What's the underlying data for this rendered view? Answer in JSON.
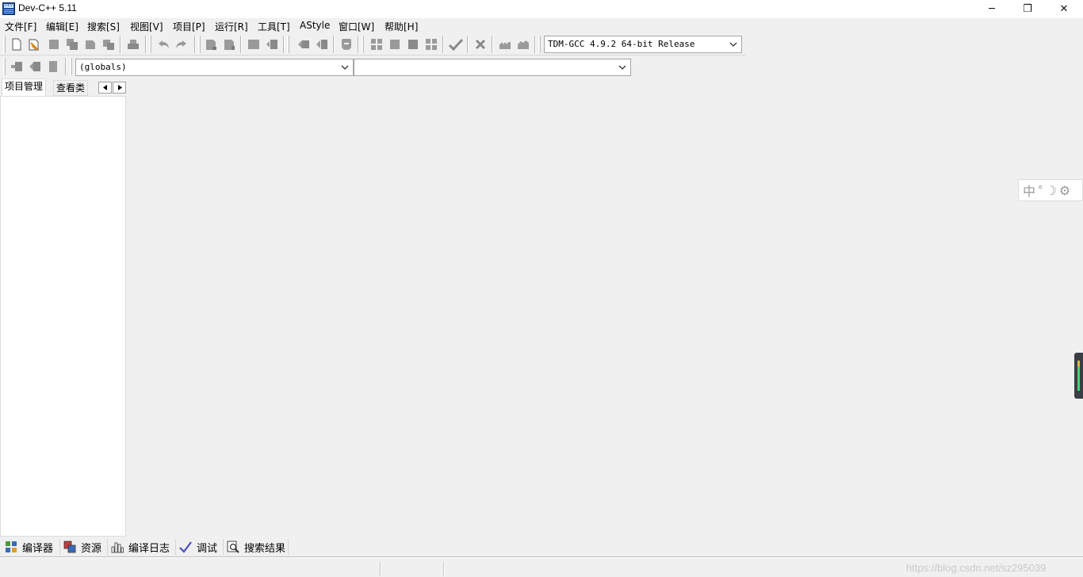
{
  "window": {
    "title": "Dev-C++ 5.11",
    "app_icon_label": "DEV",
    "controls": {
      "minimize": "─",
      "maximize": "❐",
      "close": "✕"
    }
  },
  "menubar": {
    "items": [
      {
        "label": "文件[F]"
      },
      {
        "label": "编辑[E]"
      },
      {
        "label": "搜索[S]"
      },
      {
        "label": "视图[V]"
      },
      {
        "label": "项目[P]"
      },
      {
        "label": "运行[R]"
      },
      {
        "label": "工具[T]"
      },
      {
        "label": "AStyle"
      },
      {
        "label": "窗口[W]"
      },
      {
        "label": "帮助[H]"
      }
    ]
  },
  "toolbar": {
    "compiler_select": "TDM-GCC 4.9.2 64-bit Release",
    "scope_select": "(globals)",
    "function_select": ""
  },
  "left_panel": {
    "tabs": [
      {
        "label": "项目管理",
        "active": true
      },
      {
        "label": "查看类",
        "active": false
      }
    ]
  },
  "bottom_tabs": [
    {
      "label": "编译器",
      "icon": "compiler-grid-icon"
    },
    {
      "label": "资源",
      "icon": "resources-icon"
    },
    {
      "label": "编译日志",
      "icon": "chart-icon"
    },
    {
      "label": "调试",
      "icon": "checkmark-icon"
    },
    {
      "label": "搜索结果",
      "icon": "search-doc-icon"
    }
  ],
  "statusbar": {
    "watermark": "https://blog.csdn.net/sz295039"
  },
  "ime": {
    "mode_char": "中",
    "punct": "°",
    "moon": "☽",
    "gear": "⚙"
  },
  "colors": {
    "background": "#f0f0f0",
    "panel": "#ffffff",
    "icon_gray": "#8a8a8a",
    "accent_blue": "#1f4f9e"
  }
}
